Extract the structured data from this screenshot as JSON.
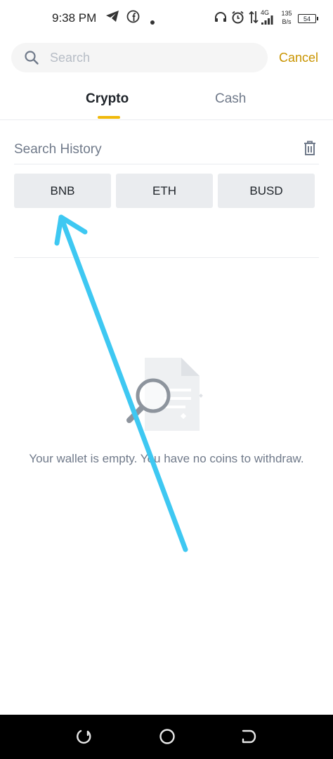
{
  "status_bar": {
    "time": "9:38 PM",
    "network": "4G",
    "speed_value": "135",
    "speed_unit": "B/s",
    "battery": "54"
  },
  "search": {
    "placeholder": "Search",
    "cancel_label": "Cancel"
  },
  "tabs": [
    {
      "label": "Crypto",
      "active": true
    },
    {
      "label": "Cash",
      "active": false
    }
  ],
  "history": {
    "title": "Search History",
    "items": [
      "BNB",
      "ETH",
      "BUSD"
    ]
  },
  "empty_state": {
    "message": "Your wallet is empty. You have no coins to withdraw."
  },
  "colors": {
    "accent": "#f0b90b",
    "cancel": "#c99400",
    "annotation_arrow": "#3ec8f2",
    "muted_text": "#707a8a",
    "chip_bg": "#eaecef"
  }
}
